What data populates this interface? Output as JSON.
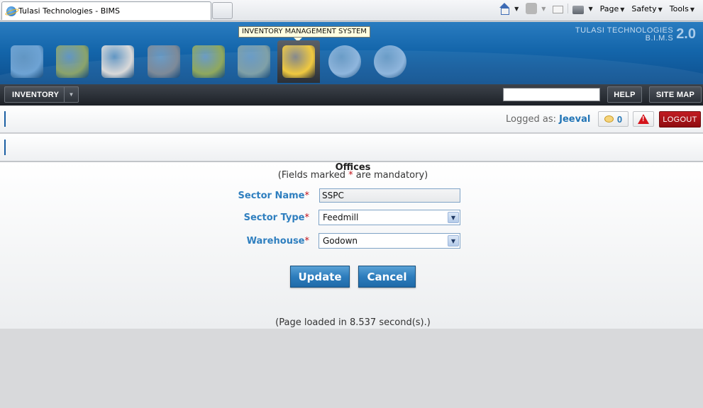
{
  "browser": {
    "tab_title": "Tulasi Technologies - BIMS",
    "commands": {
      "page": "Page",
      "safety": "Safety",
      "tools": "Tools"
    }
  },
  "header": {
    "tooltip": "INVENTORY MANAGEMENT SYSTEM",
    "brand_line1": "TULASI TECHNOLOGIES",
    "brand_line2": "B.I.M.S",
    "version": "2.0",
    "modules": [
      {
        "icon": "farm-house-icon",
        "color": "#6ea3d4"
      },
      {
        "icon": "hatchery-icon",
        "color": "#8aa36c"
      },
      {
        "icon": "poultry-bird-icon",
        "color": "#d9d9d9"
      },
      {
        "icon": "factory-icon",
        "color": "#7d8a99"
      },
      {
        "icon": "feed-bag-icon",
        "color": "#8fa85e"
      },
      {
        "icon": "accounts-machine-icon",
        "color": "#7fa0a8"
      },
      {
        "icon": "inventory-notepad-icon",
        "color": "#f0c940",
        "active": true
      },
      {
        "icon": "user-admin-icon",
        "color": "#8fb6dd"
      },
      {
        "icon": "reports-pie-chart-icon",
        "color": "#8fb6dd"
      }
    ]
  },
  "nav": {
    "inventory_label": "INVENTORY",
    "search_value": "",
    "help_label": "HELP",
    "sitemap_label": "SITE MAP"
  },
  "session": {
    "logged_as_label": "Logged as:",
    "username": "Jeeval",
    "message_count": "0",
    "logout_label": "LOGOUT"
  },
  "form": {
    "title": "Offices",
    "mandatory_prefix": "(Fields marked ",
    "mandatory_star": "*",
    "mandatory_suffix": " are mandatory)",
    "sector_name_label": "Sector Name",
    "sector_name_value": "SSPC",
    "sector_type_label": "Sector Type",
    "sector_type_value": "Feedmill",
    "warehouse_label": "Warehouse",
    "warehouse_value": "Godown",
    "required_marker": "*",
    "update_label": "Update",
    "cancel_label": "Cancel"
  },
  "footer": {
    "load_time": "(Page loaded in 8.537 second(s).)"
  }
}
